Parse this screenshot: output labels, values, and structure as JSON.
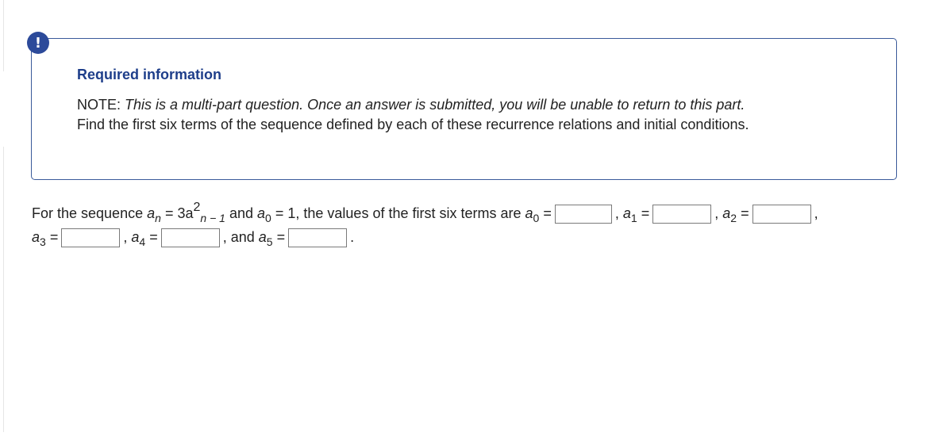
{
  "alert": {
    "icon": "exclamation-icon",
    "glyph": "!",
    "color": "#2c4a9a"
  },
  "notice": {
    "title": "Required information",
    "note_label": "NOTE:",
    "note_text": "This is a multi-part question. Once an answer is submitted, you will be unable to return to this part.",
    "instruction": "Find the first six terms of the sequence defined by each of these recurrence relations and initial conditions."
  },
  "question": {
    "intro": "For the sequence",
    "a": "a",
    "n": "n",
    "eq": "=",
    "three_a": "3a",
    "exp": "2",
    "n_minus_1": "n − 1",
    "and": "and",
    "a0_sub": "0",
    "init_eq": "= 1,",
    "phrase": "the values of the first six terms are",
    "comma": ",",
    "and_label": ", and",
    "period": ".",
    "sub0": "0",
    "sub1": "1",
    "sub2": "2",
    "sub3": "3",
    "sub4": "4",
    "sub5": "5",
    "answers": {
      "a0": "",
      "a1": "",
      "a2": "",
      "a3": "",
      "a4": "",
      "a5": ""
    }
  }
}
